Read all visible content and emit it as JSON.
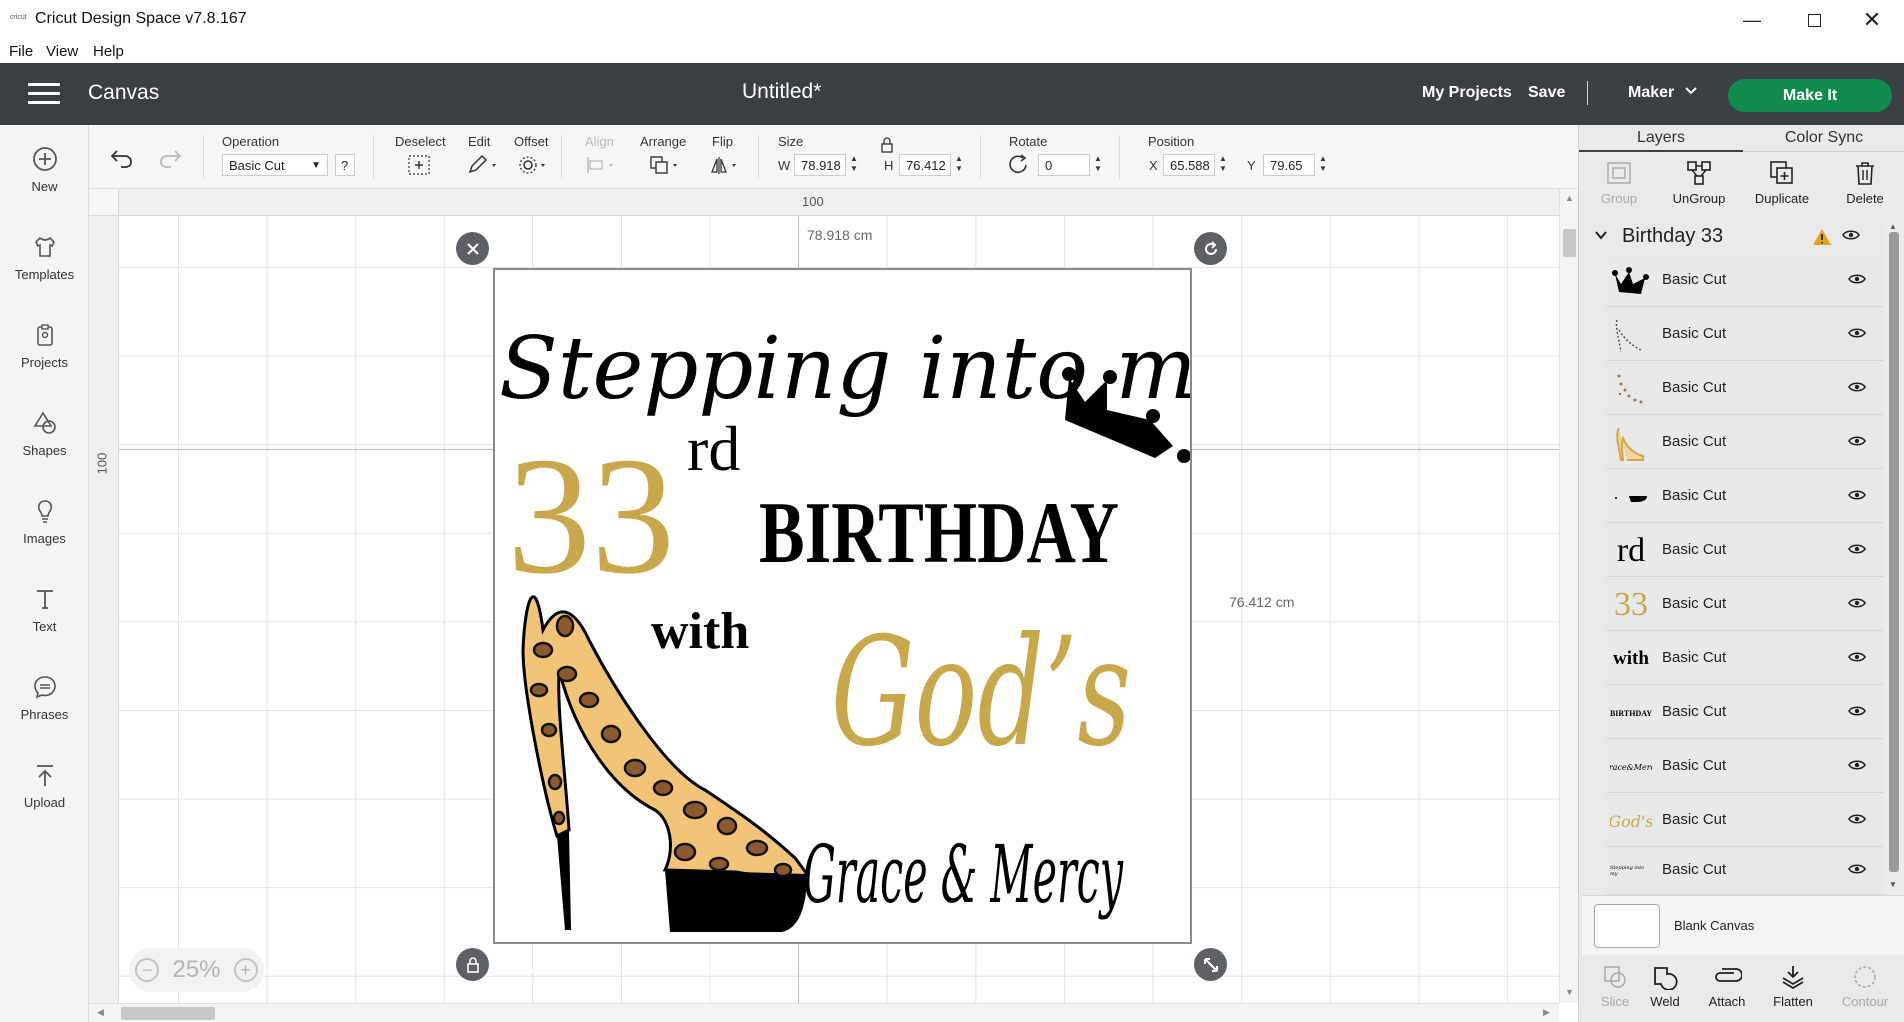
{
  "window": {
    "app_icon_text": "cricut",
    "title": "Cricut Design Space  v7.8.167",
    "controls": [
      "minimize-icon",
      "maximize-icon",
      "close-icon"
    ]
  },
  "menu": [
    "File",
    "View",
    "Help"
  ],
  "header": {
    "canvas_label": "Canvas",
    "doc_title": "Untitled*",
    "my_projects": "My Projects",
    "save": "Save",
    "separator": "|",
    "machine": "Maker",
    "make_it": "Make It",
    "colors": {
      "header_bg": "#3a3f44",
      "make_it_bg": "#0f8b4e"
    }
  },
  "sidebar": [
    {
      "label": "New",
      "icon": "plus-circle-icon"
    },
    {
      "label": "Templates",
      "icon": "shirt-icon"
    },
    {
      "label": "Projects",
      "icon": "clipboard-icon"
    },
    {
      "label": "Shapes",
      "icon": "shapes-icon"
    },
    {
      "label": "Images",
      "icon": "lightbulb-icon"
    },
    {
      "label": "Text",
      "icon": "text-icon"
    },
    {
      "label": "Phrases",
      "icon": "speech-bubble-icon"
    },
    {
      "label": "Upload",
      "icon": "upload-icon"
    }
  ],
  "toolbar": {
    "operation_label": "Operation",
    "operation_value": "Basic Cut",
    "help": "?",
    "deselect": "Deselect",
    "edit": "Edit",
    "offset": "Offset",
    "align": "Align",
    "arrange": "Arrange",
    "flip": "Flip",
    "size_label": "Size",
    "w_label": "W",
    "w_value": "78.918",
    "h_label": "H",
    "h_value": "76.412",
    "rotate_label": "Rotate",
    "rotate_value": "0",
    "position_label": "Position",
    "x_label": "X",
    "x_value": "65.588",
    "y_label": "Y",
    "y_value": "79.65"
  },
  "canvas": {
    "ruler_top_label": "100",
    "ruler_left_label": "100",
    "width_dim": "78.918 cm",
    "height_dim": "76.412 cm",
    "zoom": "25%",
    "design": {
      "line1": "Stepping into my",
      "num": "33",
      "ordinal": "rd",
      "birthday": "BIRTHDAY",
      "with": "with",
      "gods": "God’s",
      "grace": "Grace & Mercy"
    },
    "colors": {
      "gold": "#c9a84c",
      "leopard": "#f2c478",
      "spot": "#8a5a2e",
      "black": "#000000"
    }
  },
  "panel": {
    "tabs": [
      "Layers",
      "Color Sync"
    ],
    "actions": [
      {
        "label": "Group",
        "disabled": true,
        "icon": "group-icon"
      },
      {
        "label": "UnGroup",
        "disabled": false,
        "icon": "ungroup-icon"
      },
      {
        "label": "Duplicate",
        "disabled": false,
        "icon": "duplicate-icon"
      },
      {
        "label": "Delete",
        "disabled": false,
        "icon": "trash-icon"
      }
    ],
    "group_name": "Birthday 33",
    "layers": [
      {
        "thumb": "crown",
        "name": "Basic Cut"
      },
      {
        "thumb": "shoe-outline",
        "name": "Basic Cut"
      },
      {
        "thumb": "shoe-dots",
        "name": "Basic Cut"
      },
      {
        "thumb": "shoe-gold",
        "name": "Basic Cut"
      },
      {
        "thumb": "shoe-sole",
        "name": "Basic Cut"
      },
      {
        "thumb": "rd",
        "name": "Basic Cut",
        "thumb_text": "rd"
      },
      {
        "thumb": "33",
        "name": "Basic Cut",
        "thumb_text": "33"
      },
      {
        "thumb": "with",
        "name": "Basic Cut",
        "thumb_text": "with"
      },
      {
        "thumb": "birthday",
        "name": "Basic Cut",
        "thumb_text": "BIRTHDAY"
      },
      {
        "thumb": "grace",
        "name": "Basic Cut",
        "thumb_text": "Grace&Mercy"
      },
      {
        "thumb": "gods",
        "name": "Basic Cut",
        "thumb_text": "God's"
      },
      {
        "thumb": "stepping",
        "name": "Basic Cut",
        "thumb_text": "Stepping into my"
      }
    ],
    "blank_canvas": "Blank Canvas",
    "bottom_actions": [
      {
        "label": "Slice",
        "disabled": true,
        "icon": "slice-icon"
      },
      {
        "label": "Weld",
        "disabled": false,
        "icon": "weld-icon"
      },
      {
        "label": "Attach",
        "disabled": false,
        "icon": "attach-icon"
      },
      {
        "label": "Flatten",
        "disabled": false,
        "icon": "flatten-icon"
      },
      {
        "label": "Contour",
        "disabled": true,
        "icon": "contour-icon"
      }
    ]
  }
}
